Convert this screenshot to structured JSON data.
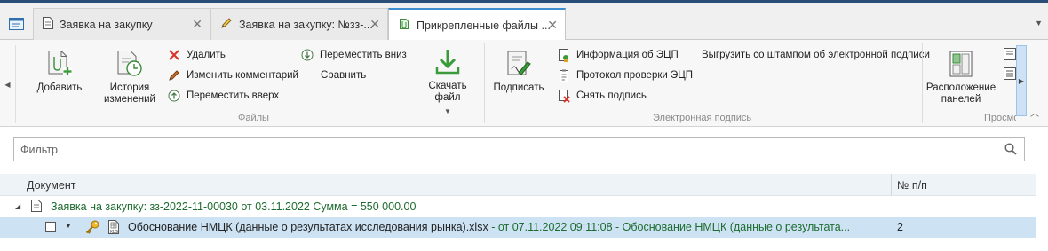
{
  "tabs": [
    {
      "label": "Заявка на закупку",
      "icon": "document-icon"
    },
    {
      "label": "Заявка на закупку: №зз-...",
      "icon": "pencil-icon"
    },
    {
      "label": "Прикрепленные файлы ...",
      "icon": "attach-icon",
      "active": true
    }
  ],
  "ribbon": {
    "files": {
      "add": "Добавить",
      "history": "История\nизменений",
      "delete": "Удалить",
      "edit_comment": "Изменить комментарий",
      "move_up": "Переместить вверх",
      "move_down": "Переместить вниз",
      "compare": "Сравнить",
      "download": "Скачать файл",
      "group_label": "Файлы"
    },
    "esign": {
      "sign": "Подписать",
      "info": "Информация об ЭЦП",
      "protocol": "Протокол проверки ЭЦП",
      "remove": "Снять подпись",
      "export_stamp": "Выгрузить со штампом об электронной подписи",
      "group_label": "Электронная подпись"
    },
    "view": {
      "layout": "Расположение\nпанелей",
      "group_label": "Просмо"
    }
  },
  "filter": {
    "placeholder": "Фильтр"
  },
  "grid": {
    "columns": {
      "document": "Документ",
      "number": "№ п/п"
    },
    "group": {
      "text": "Заявка на закупку: зз-2022-11-00030 от 03.11.2022 Сумма = 550 000.00"
    },
    "rows": [
      {
        "filename": "Обоснование НМЦК (данные о результатах исследования рынка).xlsx",
        "date": " - от 07.11.2022 09:11:08",
        "comment": " - Обоснование НМЦК (данные о результата...",
        "number": "2"
      }
    ]
  },
  "colors": {
    "accent": "#3e8ed0",
    "group_text": "#1d6b2e",
    "selected_row": "#cde3f4"
  }
}
